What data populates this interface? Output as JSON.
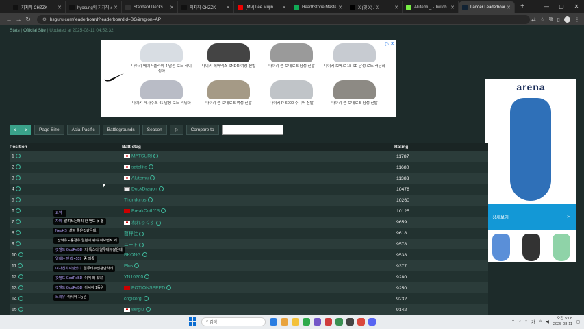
{
  "tabs": [
    {
      "label": "지지직 CHZZK",
      "color": "#111"
    },
    {
      "label": "hyosung의 지지직 스...",
      "color": "#111"
    },
    {
      "label": "Standard Decks",
      "color": "#333"
    },
    {
      "label": "지지직 CHZZK",
      "color": "#111"
    },
    {
      "label": "[MV] Lee Mujin...",
      "color": "#e00"
    },
    {
      "label": "Hearthstone Master...",
      "color": "#1a5"
    },
    {
      "label": "X (옛 X) / X",
      "color": "#000"
    },
    {
      "label": "Alutemu_ - Twitch",
      "color": "#7e4"
    },
    {
      "label": "Ladder Leaderboard",
      "color": "#123"
    }
  ],
  "url": "hsguru.com/leaderboard?leaderboardId=BG&region=AP",
  "stats_line": {
    "stats": "Stats",
    "sep": " | ",
    "official": "Official Site",
    "updated": " | Updated at 2025-08-11 04:52:32"
  },
  "ad_products": [
    {
      "name": "나이키 베이퍼플라이 4 남성 로드 레이싱화",
      "color": "#d8dde3"
    },
    {
      "name": "나이키 에어맥스 SNDR 여성 신발",
      "color": "#444"
    },
    {
      "name": "나이키 줌 보메로 5 남성 신발",
      "color": "#9a9a9a"
    },
    {
      "name": "나이키 보메로 18 SE 남성 로드 러닝화",
      "color": "#c7cbd1"
    },
    {
      "name": "나이키 페가수스 41 남성 로드 러닝화",
      "color": "#b9bcc6"
    },
    {
      "name": "나이키 줌 보메로 5 여성 신발",
      "color": "#a59a86"
    },
    {
      "name": "나이키 P-6000 주니어 신발",
      "color": "#c0c4c8"
    },
    {
      "name": "나이키 줌 보메로 5 남성 신발",
      "color": "#8d8a84"
    }
  ],
  "arena_ad": {
    "brand": "arena",
    "cta": "상세보기",
    "cta_arrow": ">"
  },
  "toolbar": {
    "prev": "<",
    "next": ">",
    "page_size": "Page Size",
    "region": "Asia-Pacific",
    "mode": "Battlegrounds",
    "season": "Season",
    "compare": "Compare to"
  },
  "table": {
    "headers": [
      "Position",
      "Battletag",
      "Rating"
    ],
    "rows": [
      {
        "pos": "1",
        "name": "MATSURI",
        "rating": "11787",
        "flag": "jp"
      },
      {
        "pos": "2",
        "name": "satellite",
        "rating": "11680",
        "flag": "jp"
      },
      {
        "pos": "3",
        "name": "Alutemu",
        "rating": "11383",
        "flag": "jp"
      },
      {
        "pos": "4",
        "name": "DuckDragon",
        "rating": "10478",
        "flag": "kr"
      },
      {
        "pos": "5",
        "name": "Thundurus",
        "rating": "10260",
        "flag": ""
      },
      {
        "pos": "6",
        "name": "BreakOutLYS",
        "rating": "10125",
        "flag": "tw"
      },
      {
        "pos": "7",
        "name": "れれっくす",
        "rating": "9659",
        "flag": "jp"
      },
      {
        "pos": "8",
        "name": "茴秤佳",
        "rating": "9618",
        "flag": ""
      },
      {
        "pos": "9",
        "name": "ニート",
        "rating": "9578",
        "flag": ""
      },
      {
        "pos": "10",
        "name": "BKONG",
        "rating": "9538",
        "flag": ""
      },
      {
        "pos": "11",
        "name": "Plus",
        "rating": "9377",
        "flag": ""
      },
      {
        "pos": "12",
        "name": "YN10205",
        "rating": "9280",
        "flag": ""
      },
      {
        "pos": "13",
        "name": "POTIONSPEED",
        "rating": "9250",
        "flag": "tw"
      },
      {
        "pos": "14",
        "name": "cogicorgi",
        "rating": "9232",
        "flag": ""
      },
      {
        "pos": "15",
        "name": "sergiu",
        "rating": "9142",
        "flag": "jp"
      }
    ]
  },
  "chat": [
    {
      "user": "요약",
      "text": ""
    },
    {
      "user": "차미",
      "text": "살려쓰는패리 한 번도 못 봄"
    },
    {
      "user": "NeoHS",
      "text": "살짜 좋은것같은데."
    },
    {
      "user": "",
      "text": "잔약유도용경우 일본이 뭐냐 뭐보면서 왜"
    },
    {
      "user": "갓헬드 GodReBD",
      "text": "저 톡스리 알루테무잖은데"
    },
    {
      "user": "일내는 만렙 4559",
      "text": "중 꽤좀"
    },
    {
      "user": "여자친하지않았다",
      "text": "알루테무전갱안하네"
    },
    {
      "user": "갓헬드 GodReBD",
      "text": "이게 왜 맞냐"
    },
    {
      "user": "갓헬드 GodReBD",
      "text": "아시아 1등임"
    },
    {
      "user": "브리유",
      "text": "아시아 1등임"
    }
  ],
  "taskbar": {
    "search": "검색",
    "time": "오전 5:08",
    "date": "2025-08-11",
    "lang": "가"
  }
}
